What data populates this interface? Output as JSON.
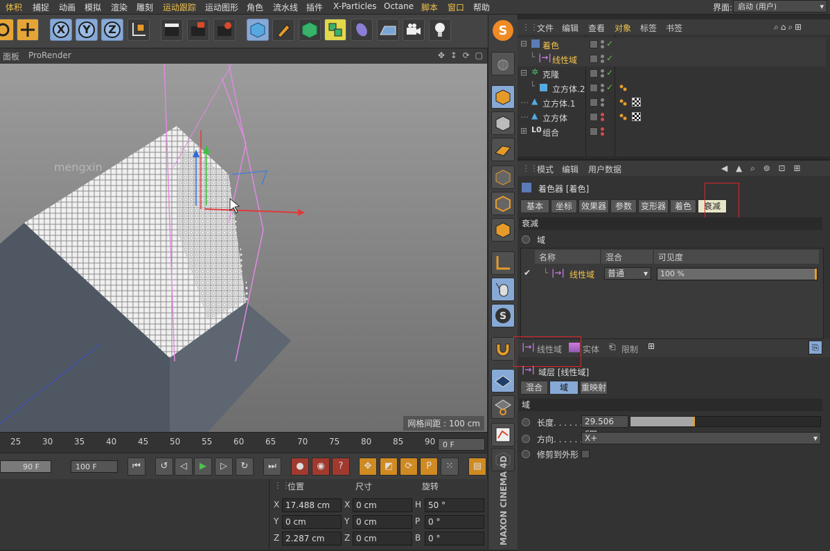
{
  "menu": {
    "items": [
      "体积",
      "捕捉",
      "动画",
      "模拟",
      "渲染",
      "雕刻",
      "运动跟踪",
      "运动图形",
      "角色",
      "流水线",
      "插件",
      "X-Particles",
      "Octane",
      "脚本",
      "窗口",
      "帮助"
    ],
    "layout_label": "界面:",
    "layout_value": "启动 (用户)"
  },
  "viewport": {
    "tabs": [
      "面板",
      "ProRender"
    ],
    "watermark": "mengxin",
    "grid_info": "网格间距 : 100 cm"
  },
  "timeline": {
    "ticks": [
      "25",
      "30",
      "35",
      "40",
      "45",
      "50",
      "55",
      "60",
      "65",
      "70",
      "75",
      "80",
      "85",
      "90"
    ],
    "current_frame": "0 F",
    "start_frame": "90 F",
    "end_frame": "100 F"
  },
  "coords": {
    "headers": [
      "位置",
      "尺寸",
      "旋转"
    ],
    "rows": [
      {
        "axis": "X",
        "pos": "17.488 cm",
        "size_axis": "X",
        "size": "0 cm",
        "rot_axis": "H",
        "rot": "50 °"
      },
      {
        "axis": "Y",
        "pos": "0 cm",
        "size_axis": "Y",
        "size": "0 cm",
        "rot_axis": "P",
        "rot": "0 °"
      },
      {
        "axis": "Z",
        "pos": "2.287 cm",
        "size_axis": "Z",
        "size": "0 cm",
        "rot_axis": "B",
        "rot": "0 °"
      }
    ]
  },
  "palette_logo": "MAXON CINEMA 4D",
  "objmgr": {
    "menus": [
      "文件",
      "编辑",
      "查看",
      "对象",
      "标签",
      "书签"
    ],
    "objects": [
      {
        "name": "着色",
        "indent": 0,
        "selected": true
      },
      {
        "name": "线性域",
        "indent": 1,
        "selected": true
      },
      {
        "name": "克隆",
        "indent": 0,
        "selected": false
      },
      {
        "name": "立方体.2",
        "indent": 1,
        "selected": false
      },
      {
        "name": "立方体.1",
        "indent": 0,
        "selected": false
      },
      {
        "name": "立方体",
        "indent": 0,
        "selected": false
      },
      {
        "name": "组合",
        "indent": 0,
        "selected": false
      }
    ]
  },
  "attrmgr": {
    "menus": [
      "模式",
      "编辑",
      "用户数据"
    ],
    "object_title": "着色器 [着色]",
    "tabs": [
      "基本",
      "坐标",
      "效果器",
      "参数",
      "变形器",
      "着色",
      "衰减"
    ],
    "section_falloff": "衰减",
    "field_group": "域",
    "list_headers": [
      "名称",
      "混合",
      "可见度"
    ],
    "field_row": {
      "name": "线性域",
      "blend": "普通",
      "visibility": "100 %",
      "visibility_fraction": 1.0
    },
    "field_buttons": [
      "线性域",
      "实体",
      "限制"
    ],
    "sub_title": "域层 [线性域]",
    "sub_tabs": [
      "混合",
      "域",
      "重映射"
    ],
    "sub_section": "域",
    "length_label": "长度. . . . . .",
    "length_value": "29.506 cm",
    "length_fraction": 0.34,
    "direction_label": "方向. . . . . . . .",
    "direction_value": "X+",
    "clip_label": "修剪到外形"
  }
}
